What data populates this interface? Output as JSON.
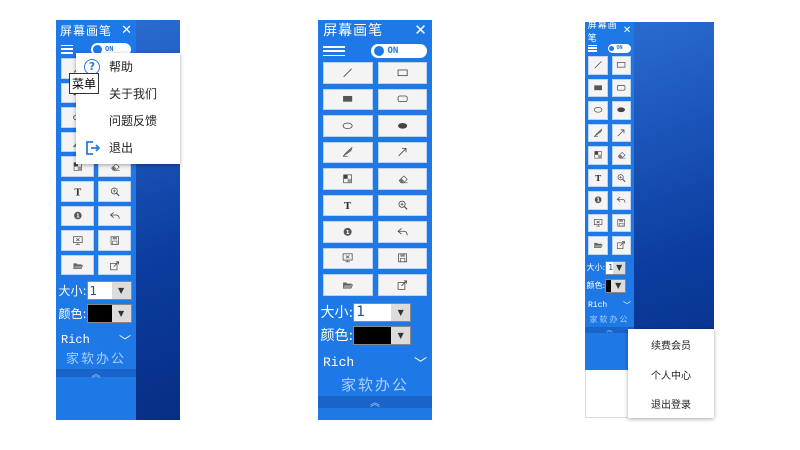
{
  "app": {
    "title": "屏幕画笔",
    "close": "✕",
    "toggle_label": "ON"
  },
  "tools": [
    {
      "name": "line-tool-icon"
    },
    {
      "name": "rectangle-outline-tool-icon"
    },
    {
      "name": "filled-rectangle-tool-icon"
    },
    {
      "name": "rounded-rectangle-tool-icon"
    },
    {
      "name": "ellipse-outline-tool-icon"
    },
    {
      "name": "filled-ellipse-tool-icon"
    },
    {
      "name": "pen-tool-icon"
    },
    {
      "name": "arrow-tool-icon"
    },
    {
      "name": "mosaic-tool-icon"
    },
    {
      "name": "eraser-tool-icon"
    },
    {
      "name": "text-tool-icon"
    },
    {
      "name": "magnifier-tool-icon"
    },
    {
      "name": "number-tool-icon"
    },
    {
      "name": "undo-icon"
    },
    {
      "name": "clear-screen-icon"
    },
    {
      "name": "save-icon"
    },
    {
      "name": "open-folder-icon"
    },
    {
      "name": "export-icon"
    }
  ],
  "size": {
    "label": "大小:",
    "value": "1"
  },
  "color": {
    "label": "颜色:",
    "value": "#000000"
  },
  "rich": {
    "label": "Rich",
    "chevron": "﹀"
  },
  "brand": "家软办公",
  "bottom_chevron": "︽",
  "number_badge": "1",
  "text_glyph": "T",
  "left_menu": {
    "tooltip": "菜单",
    "items": [
      {
        "label": "帮助",
        "icon": "help-icon"
      },
      {
        "label": "关于我们",
        "icon": ""
      },
      {
        "label": "问题反馈",
        "icon": ""
      },
      {
        "label": "退出",
        "icon": "logout-icon"
      }
    ]
  },
  "right_menu": {
    "items": [
      {
        "label": "续费会员"
      },
      {
        "label": "个人中心"
      },
      {
        "label": "退出登录"
      }
    ]
  },
  "colors": {
    "panel": "#1e78e6",
    "accent": "#1a63c8"
  }
}
